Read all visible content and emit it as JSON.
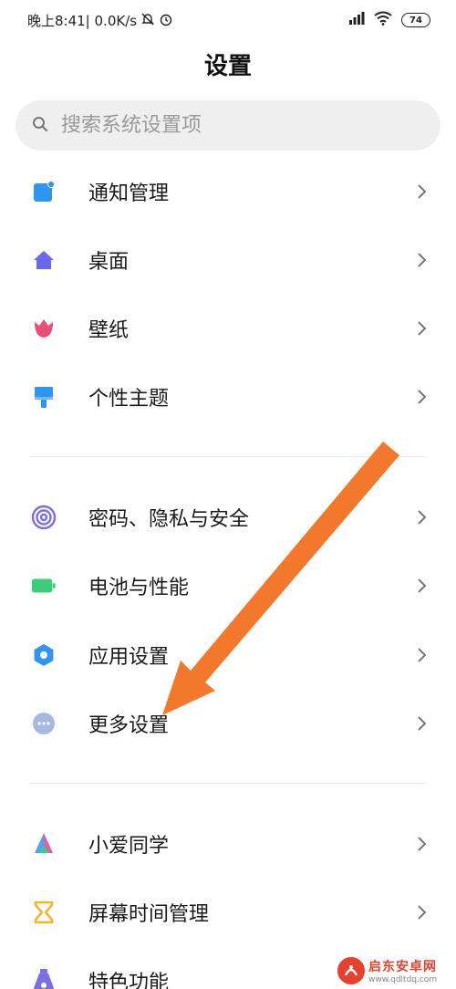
{
  "status_bar": {
    "left_text": "晚上8:41| 0.0K/s",
    "battery": "74"
  },
  "header": {
    "title": "设置"
  },
  "search": {
    "placeholder": "搜索系统设置项"
  },
  "groups": [
    {
      "items": [
        {
          "label": "通知管理",
          "icon": "notification-icon",
          "color": "#2e96f0"
        },
        {
          "label": "桌面",
          "icon": "home-icon",
          "color": "#6a6ae8"
        },
        {
          "label": "壁纸",
          "icon": "tulip-icon",
          "color": "#ea4e74"
        },
        {
          "label": "个性主题",
          "icon": "paint-brush-icon",
          "color": "#2e96f0"
        }
      ]
    },
    {
      "items": [
        {
          "label": "密码、隐私与安全",
          "icon": "fingerprint-icon",
          "color": "#7b6fe6"
        },
        {
          "label": "电池与性能",
          "icon": "battery-icon",
          "color": "#3ccd7a"
        },
        {
          "label": "应用设置",
          "icon": "gear-icon",
          "color": "#2e96f0"
        },
        {
          "label": "更多设置",
          "icon": "more-dots-icon",
          "color": "#a7b8e3"
        }
      ]
    },
    {
      "items": [
        {
          "label": "小爱同学",
          "icon": "xiaoai-icon",
          "color": "#4da3ff"
        },
        {
          "label": "屏幕时间管理",
          "icon": "hourglass-icon",
          "color": "#f2b634"
        },
        {
          "label": "特色功能",
          "icon": "feature-flask-icon",
          "color": "#7b6fe6"
        }
      ]
    }
  ],
  "annotation": {
    "arrow_color": "#f4782c"
  },
  "watermark": {
    "title": "启东安卓网",
    "url": "www.qdltdq.com"
  }
}
